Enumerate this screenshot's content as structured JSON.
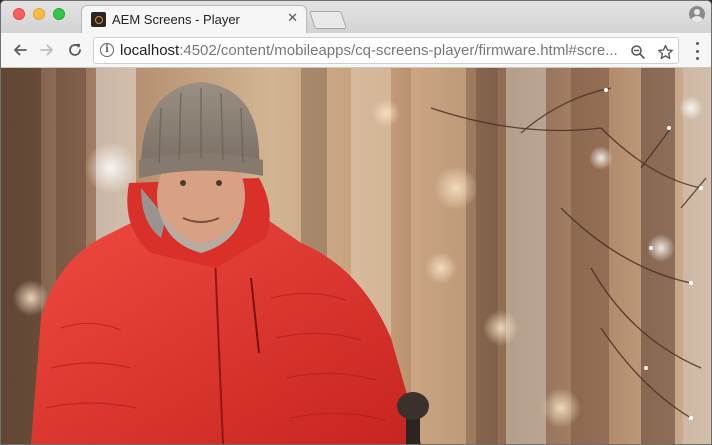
{
  "window": {
    "traffic_lights": [
      "close",
      "minimize",
      "maximize"
    ]
  },
  "tab": {
    "title": "AEM Screens - Player",
    "close_glyph": "✕",
    "favicon": "aem-screens-favicon-icon"
  },
  "toolbar": {
    "back_icon": "arrow-left-icon",
    "forward_icon": "arrow-right-icon",
    "reload_icon": "reload-icon",
    "url_host": "localhost",
    "url_rest": ":4502/content/mobileapps/cq-screens-player/firmware.html#scre...",
    "info_glyph": "i",
    "zoom_icon": "magnifier-icon",
    "bookmark_icon": "star-icon",
    "menu_icon": "more-vertical-icon"
  },
  "content": {
    "image_subject": "smiling man in red down jacket and grey knit hat in snowy birch forest",
    "colors": {
      "jacket": "#e0342d",
      "hat": "#8b8076",
      "background_warm": "#c9a27c"
    }
  }
}
